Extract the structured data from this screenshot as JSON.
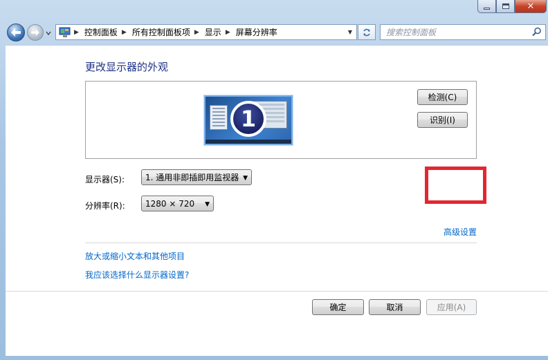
{
  "window": {
    "caption": {
      "minimize": "—",
      "maximize": "□",
      "close": "✕"
    }
  },
  "nav": {
    "breadcrumb": [
      "控制面板",
      "所有控制面板项",
      "显示",
      "屏幕分辨率"
    ],
    "search_placeholder": "搜索控制面板"
  },
  "page": {
    "title": "更改显示器的外观",
    "monitor_number": "1",
    "detect_label": "检测(C)",
    "identify_label": "识别(I)",
    "display_label": "显示器(S):",
    "display_value": "1. 通用非即插即用监视器",
    "resolution_label": "分辨率(R):",
    "resolution_value": "1280 × 720",
    "advanced_link": "高级设置",
    "link_text_size": "放大或缩小文本和其他项目",
    "link_which_settings": "我应该选择什么显示器设置?"
  },
  "footer": {
    "ok_label": "确定",
    "cancel_label": "取消",
    "apply_label": "应用(A)"
  },
  "colors": {
    "title": "#1e3287",
    "link": "#0066cc",
    "highlight": "#e4262f"
  }
}
